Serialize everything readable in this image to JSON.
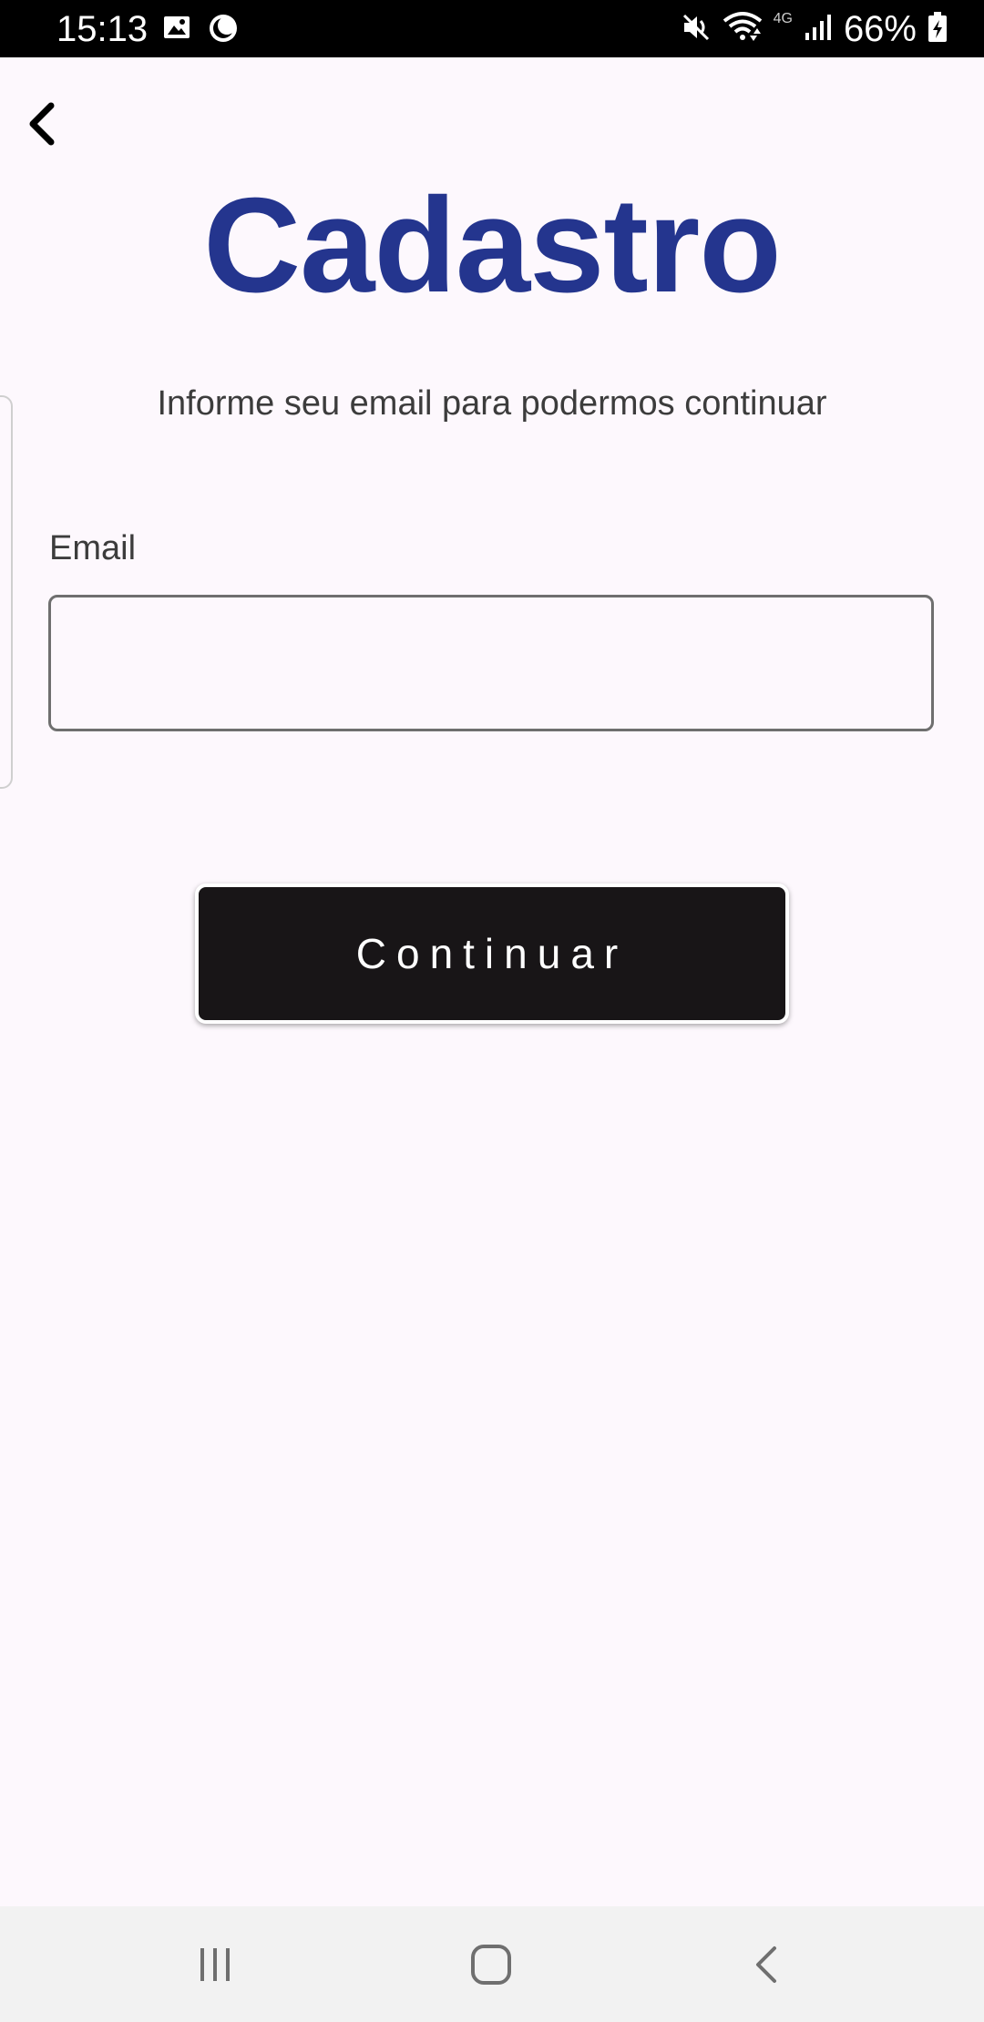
{
  "status_bar": {
    "time": "15:13",
    "battery": "66%",
    "network_type": "4G",
    "icons": [
      "image-icon",
      "moon-icon",
      "mute-icon",
      "wifi-icon",
      "signal-icon",
      "battery-charging-icon"
    ]
  },
  "header": {
    "back_icon": "chevron-left-icon"
  },
  "main": {
    "title": "Cadastro",
    "subtitle": "Informe seu email para podermos continuar",
    "email_label": "Email",
    "email_value": "",
    "continue_label": "Continuar"
  },
  "nav_bar": {
    "icons": [
      "recents-icon",
      "home-icon",
      "back-icon"
    ]
  },
  "colors": {
    "title": "#24358e",
    "background": "#fdf8fd",
    "button": "#181517",
    "status_bar": "#000000"
  }
}
